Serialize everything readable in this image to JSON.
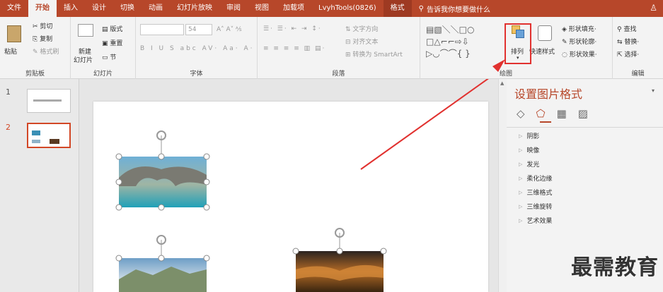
{
  "tabs": [
    {
      "label": "文件"
    },
    {
      "label": "开始"
    },
    {
      "label": "插入"
    },
    {
      "label": "设计"
    },
    {
      "label": "切换"
    },
    {
      "label": "动画"
    },
    {
      "label": "幻灯片放映"
    },
    {
      "label": "审阅"
    },
    {
      "label": "视图"
    },
    {
      "label": "加载项"
    },
    {
      "label": "LvyhTools(0826)"
    },
    {
      "label": "格式"
    }
  ],
  "tell_me": "告诉我你想要做什么",
  "clipboard": {
    "paste": "粘贴",
    "cut": "剪切",
    "copy": "复制",
    "format_painter": "格式刷",
    "label": "剪贴板"
  },
  "slides_group": {
    "new_slide": "新建",
    "new_slide2": "幻灯片",
    "layout": "版式",
    "reset": "重置",
    "section": "节",
    "label": "幻灯片"
  },
  "font_group": {
    "font_size": "54",
    "label": "字体"
  },
  "paragraph_group": {
    "text_direction": "文字方向",
    "align_text": "对齐文本",
    "convert_smartart": "转换为 SmartArt",
    "label": "段落"
  },
  "drawing_group": {
    "arrange": "排列",
    "quick_styles": "快速样式",
    "shape_fill": "形状填充",
    "shape_outline": "形状轮廓",
    "shape_effects": "形状效果",
    "label": "绘图"
  },
  "editing_group": {
    "find": "查找",
    "replace": "替换",
    "select": "选择",
    "label": "编辑"
  },
  "slide_numbers": [
    "1",
    "2"
  ],
  "pane": {
    "title": "设置图片格式",
    "items": [
      "阴影",
      "映像",
      "发光",
      "柔化边缘",
      "三维格式",
      "三维旋转",
      "艺术效果"
    ]
  },
  "watermark": "最需教育",
  "colors": {
    "accent": "#b7472a",
    "highlight": "#e1312f"
  }
}
